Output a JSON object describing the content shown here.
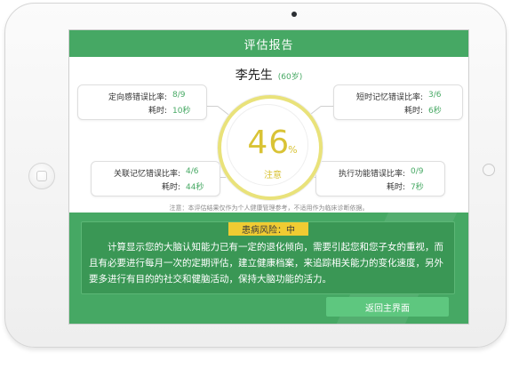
{
  "header": {
    "title": "评估报告"
  },
  "patient": {
    "name": "李先生",
    "age": "(60岁)"
  },
  "metrics": [
    {
      "label1": "定向感错误比率:",
      "value1": "8/9",
      "label2": "耗时:",
      "value2": "10秒"
    },
    {
      "label1": "短时记忆错误比率:",
      "value1": "3/6",
      "label2": "耗时:",
      "value2": "6秒"
    },
    {
      "label1": "关联记忆错误比率:",
      "value1": "4/6",
      "label2": "耗时:",
      "value2": "44秒"
    },
    {
      "label1": "执行功能错误比率:",
      "value1": "0/9",
      "label2": "耗时:",
      "value2": "7秒"
    }
  ],
  "gauge": {
    "value": "46",
    "unit": "%",
    "status": "注意"
  },
  "note": "注意：本评估结果仅作为个人健康管理参考，不适用作为临床诊断依据。",
  "risk": {
    "badge": "患病风险：中",
    "text": "计算显示您的大脑认知能力已有一定的退化倾向，需要引起您和您子女的重视，而且有必要进行每月一次的定期评估，建立健康档案，来追踪相关能力的变化速度，另外要多进行有目的的社交和健脑活动，保持大脑功能的活力。"
  },
  "back_button": "返回主界面",
  "colors": {
    "green": "#46a864",
    "gauge": "#d9c335",
    "badge": "#f0cb32",
    "button": "#5ec77f"
  }
}
